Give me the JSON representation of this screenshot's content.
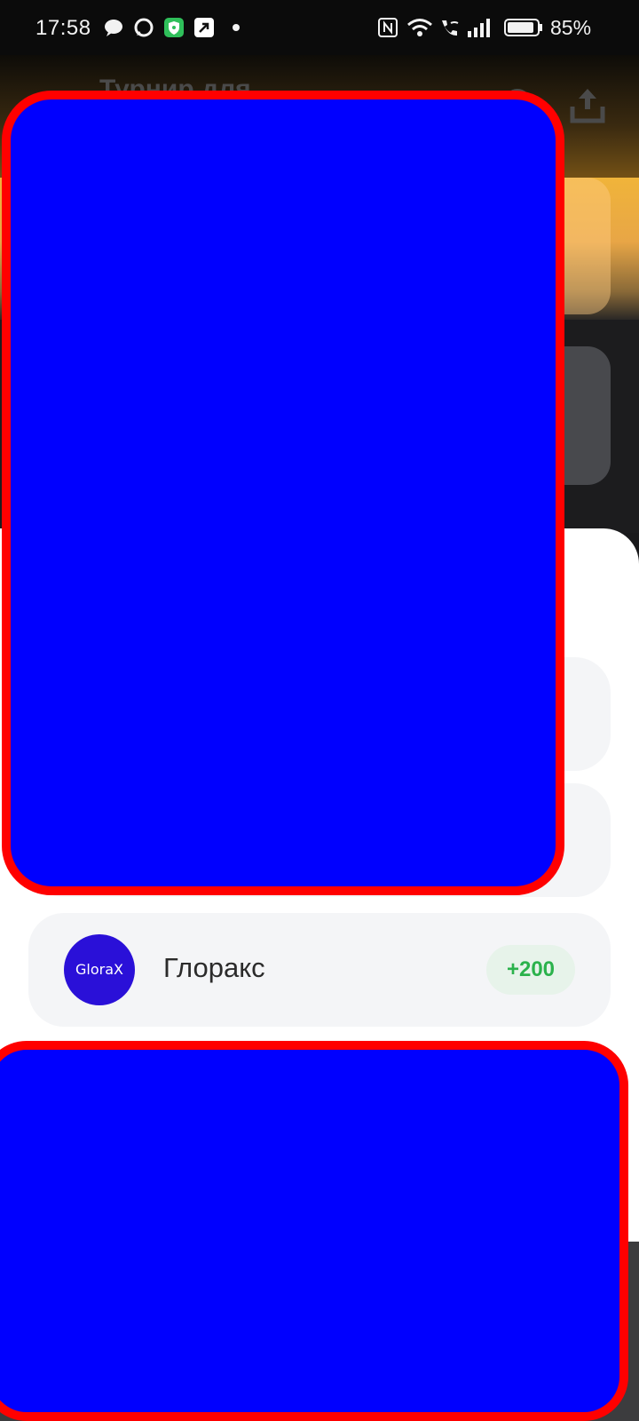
{
  "status_bar": {
    "time": "17:58",
    "battery_percent": "85%",
    "notification_icons": [
      "chat-bubble-icon",
      "message-icon",
      "shield-icon",
      "arrow-app-icon",
      "dot-icon"
    ],
    "system_icons": [
      "nfc-icon",
      "wifi-icon",
      "wifi-call-icon",
      "signal-icon",
      "battery-icon"
    ]
  },
  "header": {
    "title": "Турнир для",
    "actions": [
      "help-icon",
      "share-icon"
    ]
  },
  "list": {
    "rows": [
      {
        "name": "Глоракс",
        "logo_text": "GloraX",
        "points": "+200"
      }
    ]
  },
  "colors": {
    "accent_green": "#2bb24c",
    "logo_bg": "#2a10d8",
    "redaction_fill": "#0000ff",
    "redaction_border": "#ff0000"
  }
}
